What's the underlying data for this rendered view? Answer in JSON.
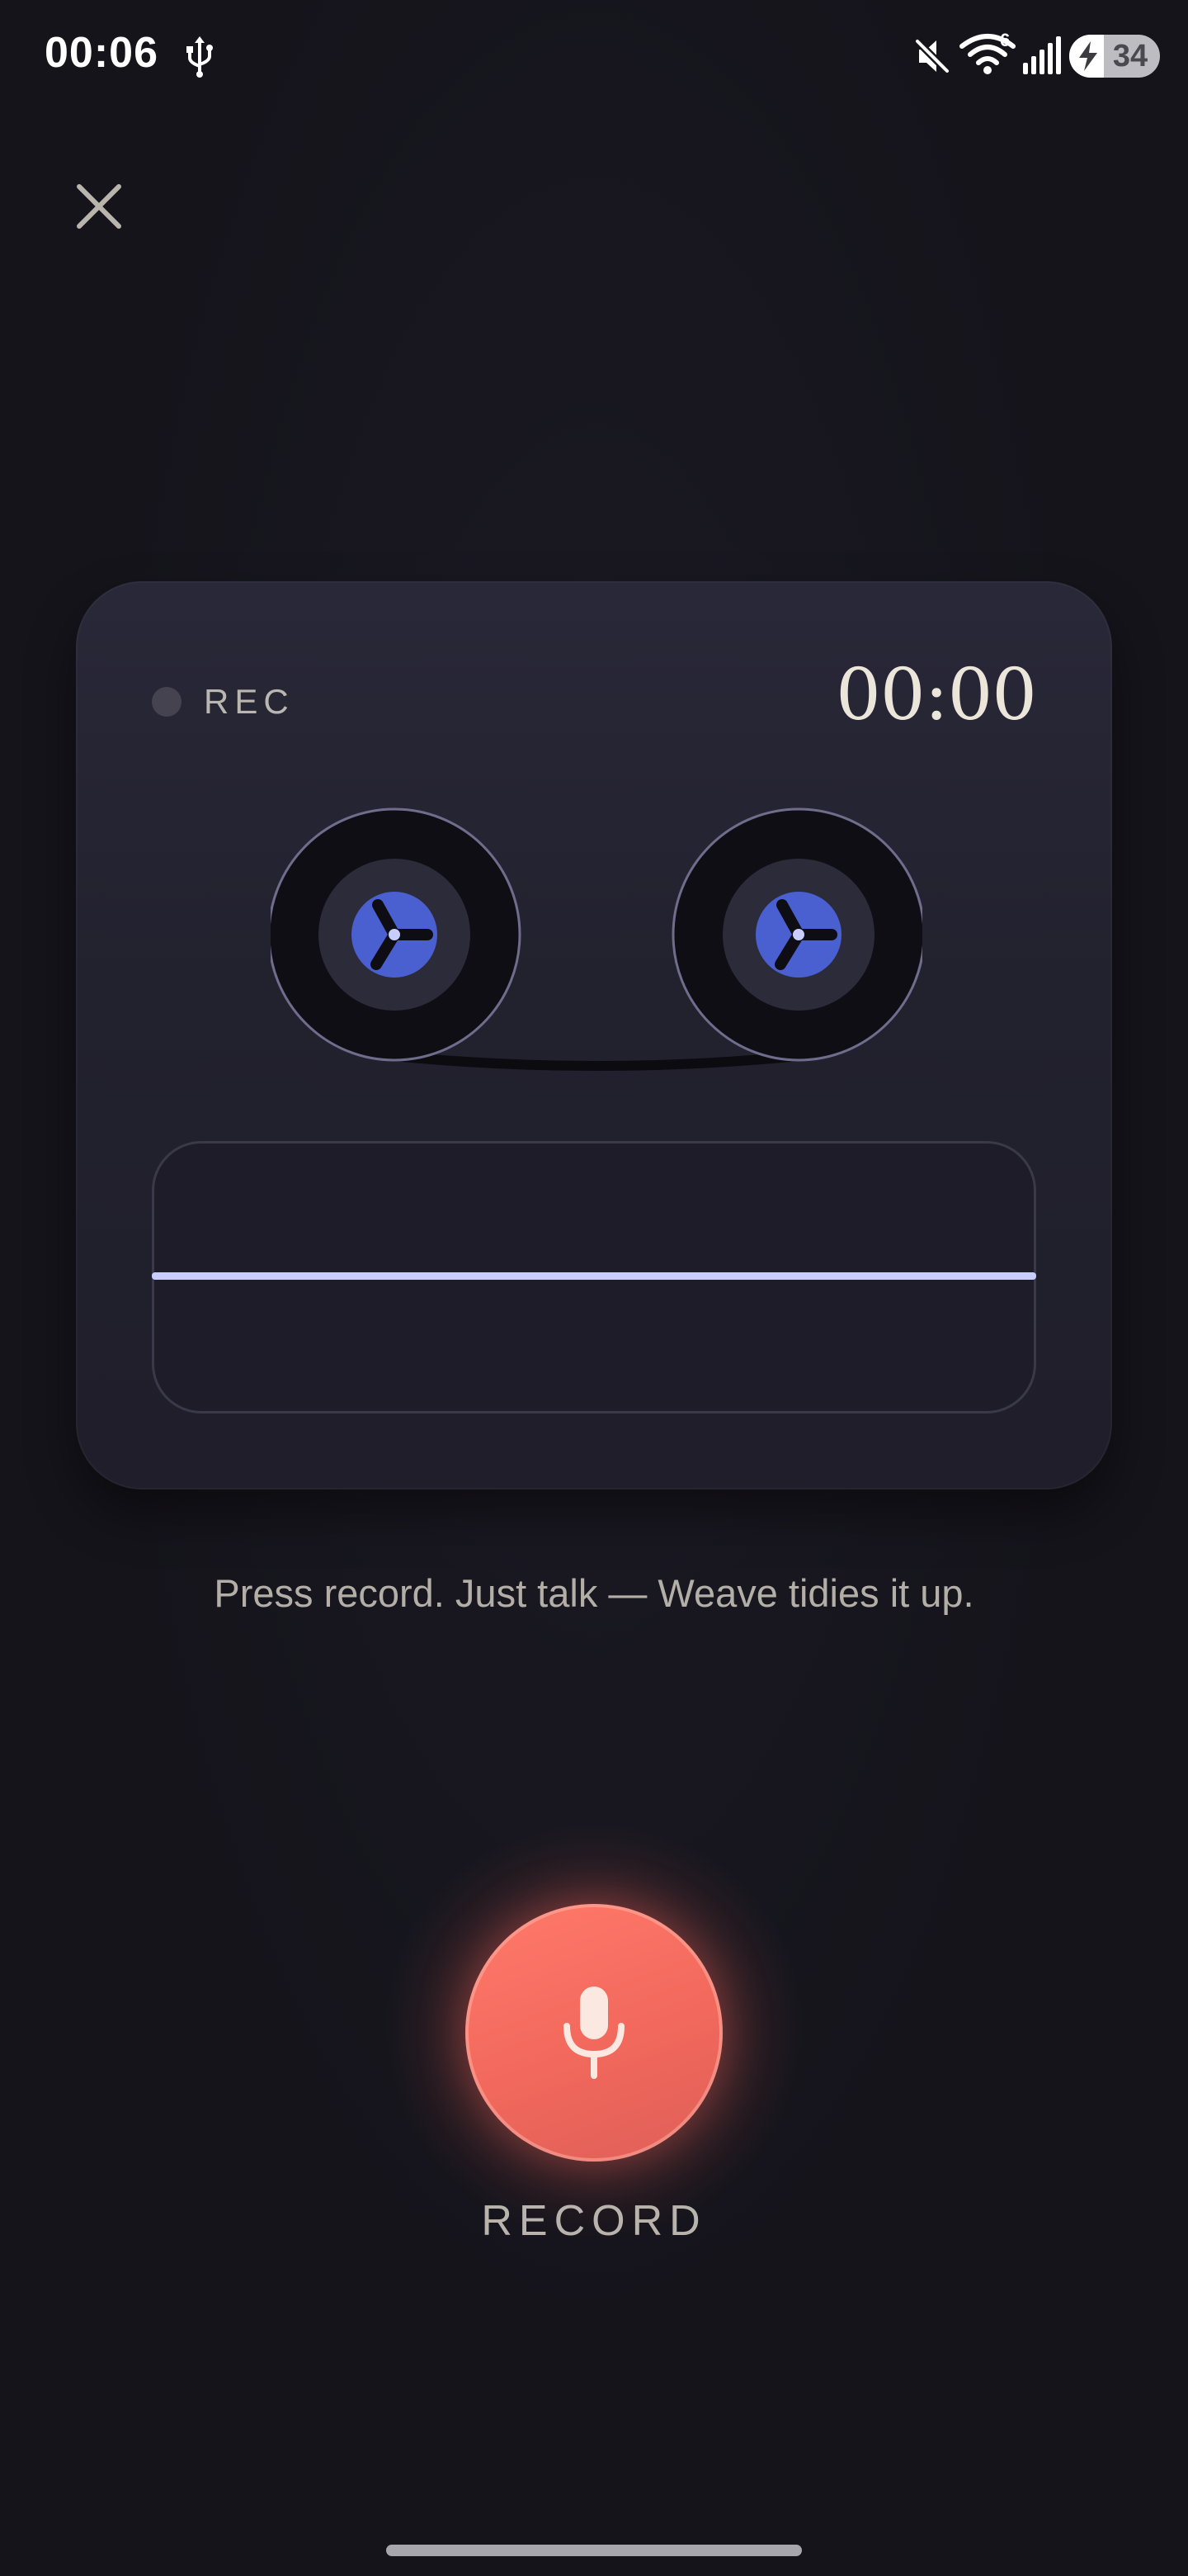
{
  "status_bar": {
    "time": "00:06",
    "battery_level": "34",
    "wifi_badge": "6"
  },
  "recorder": {
    "rec_label": "REC",
    "timer": "00:00"
  },
  "prompt": "Press record. Just talk — Weave tidies it up.",
  "record_button": {
    "label": "RECORD"
  },
  "colors": {
    "background": "#15141b",
    "card": "#262534",
    "reel_hub": "#4a5fd0",
    "waveform": "#c7cdff",
    "record_accent": "#f46b5e"
  },
  "icons": {
    "close": "close-icon",
    "record": "microphone-icon",
    "usb": "usb-icon",
    "mute": "mute-icon",
    "wifi": "wifi-icon",
    "signal": "signal-icon",
    "battery": "battery-icon"
  }
}
